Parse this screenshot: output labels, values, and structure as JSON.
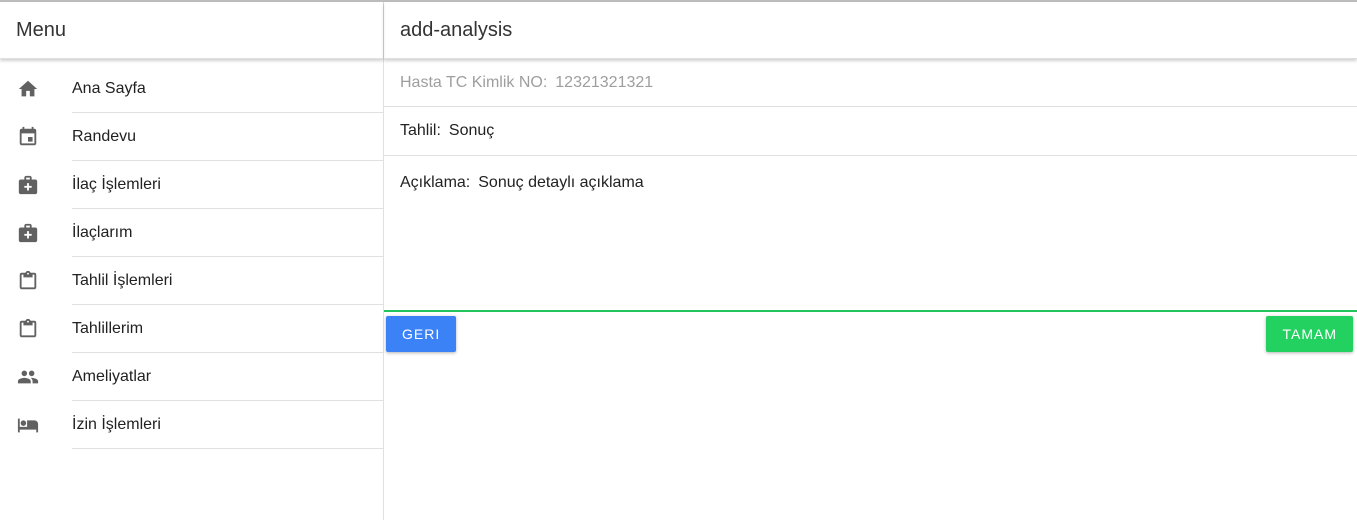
{
  "sidebar": {
    "title": "Menu",
    "items": [
      {
        "label": "Ana Sayfa",
        "icon": "home-icon"
      },
      {
        "label": "Randevu",
        "icon": "calendar-icon"
      },
      {
        "label": "İlaç İşlemleri",
        "icon": "medical-bag-icon"
      },
      {
        "label": "İlaçlarım",
        "icon": "medical-bag-icon"
      },
      {
        "label": "Tahlil İşlemleri",
        "icon": "clipboard-icon"
      },
      {
        "label": "Tahlillerim",
        "icon": "clipboard-icon"
      },
      {
        "label": "Ameliyatlar",
        "icon": "people-icon"
      },
      {
        "label": "İzin İşlemleri",
        "icon": "bed-icon"
      }
    ]
  },
  "main": {
    "title": "add-analysis",
    "fields": {
      "tc": {
        "label": "Hasta TC Kimlik NO:",
        "value": "12321321321"
      },
      "tahlil": {
        "label": "Tahlil:",
        "value": "Sonuç"
      },
      "aciklama": {
        "label": "Açıklama:",
        "value": "Sonuç detaylı açıklama"
      }
    },
    "buttons": {
      "back": "GERI",
      "ok": "TAMAM"
    }
  },
  "colors": {
    "back_button": "#3b82f6",
    "ok_button": "#22d160",
    "active_underline": "#22c55e",
    "icon": "#616161"
  }
}
